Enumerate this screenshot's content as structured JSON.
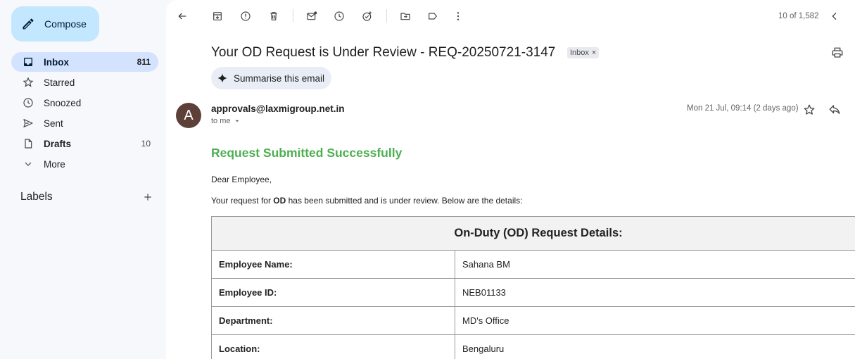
{
  "sidebar": {
    "compose_label": "Compose",
    "items": [
      {
        "label": "Inbox",
        "count": "811",
        "icon": "inbox-icon"
      },
      {
        "label": "Starred",
        "count": "",
        "icon": "star-icon"
      },
      {
        "label": "Snoozed",
        "count": "",
        "icon": "clock-icon"
      },
      {
        "label": "Sent",
        "count": "",
        "icon": "send-icon"
      },
      {
        "label": "Drafts",
        "count": "10",
        "icon": "file-icon"
      },
      {
        "label": "More",
        "count": "",
        "icon": "chevron-down-icon"
      }
    ],
    "labels_heading": "Labels"
  },
  "toolbar": {
    "pager": "10 of 1,582"
  },
  "email": {
    "subject": "Your OD Request is Under Review - REQ-20250721-3147",
    "label_chip": "Inbox",
    "label_chip_close": "×",
    "summarise_label": "Summarise this email",
    "avatar_letter": "A",
    "sender": "approvals@laxmigroup.net.in",
    "to": "to me",
    "date": "Mon 21 Jul, 09:14 (2 days ago)",
    "body_title": "Request Submitted Successfully",
    "greeting": "Dear Employee,",
    "para_prefix": "Your request for ",
    "para_bold": "OD",
    "para_suffix": " has been submitted and is under review. Below are the details:",
    "table_title": "On-Duty (OD) Request Details:",
    "rows": [
      {
        "key": "Employee Name:",
        "value": "Sahana BM"
      },
      {
        "key": "Employee ID:",
        "value": "NEB01133"
      },
      {
        "key": "Department:",
        "value": "MD's Office"
      },
      {
        "key": "Location:",
        "value": "Bengaluru"
      }
    ]
  },
  "colors": {
    "compose_bg": "#c2e7ff",
    "active_nav_bg": "#d3e3fd",
    "title_green": "#4caf50",
    "avatar_bg": "#5d4037"
  }
}
